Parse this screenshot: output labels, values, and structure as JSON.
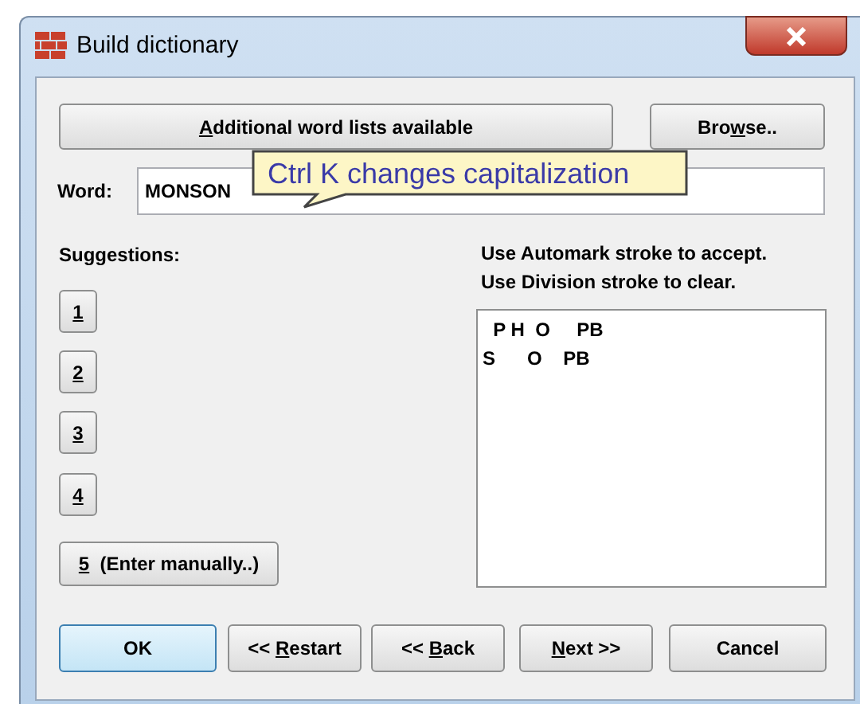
{
  "window": {
    "title": "Build dictionary"
  },
  "top_buttons": [
    {
      "label": [
        {
          "text": "A",
          "underlined": true
        },
        {
          "text": "dditional word lists available",
          "underlined": false
        }
      ]
    },
    {
      "label": [
        {
          "text": "Bro",
          "underlined": false
        },
        {
          "text": "w",
          "underlined": true
        },
        {
          "text": "se..",
          "underlined": false
        }
      ]
    }
  ],
  "word": {
    "label": "Word:",
    "value": "MONSON"
  },
  "tooltip": {
    "text": "Ctrl K changes capitalization"
  },
  "suggestions": {
    "label": "Suggestions:",
    "buttons": [
      {
        "label": [
          {
            "text": "1",
            "underlined": true
          }
        ]
      },
      {
        "label": [
          {
            "text": "2",
            "underlined": true
          }
        ]
      },
      {
        "label": [
          {
            "text": "3",
            "underlined": true
          }
        ]
      },
      {
        "label": [
          {
            "text": "4",
            "underlined": true
          }
        ]
      },
      {
        "label": [
          {
            "text": "5",
            "underlined": true
          },
          {
            "text": "  (Enter manually..)",
            "underlined": false
          }
        ]
      }
    ]
  },
  "instructions": [
    "Use Automark stroke to accept.",
    "Use Division stroke to clear."
  ],
  "strokes": [
    "  P H  O     PB",
    "S      O    PB"
  ],
  "bottom_buttons": [
    {
      "label": [
        {
          "text": "OK",
          "underlined": false
        }
      ],
      "default": true
    },
    {
      "label": [
        {
          "text": "<< ",
          "underlined": false
        },
        {
          "text": "R",
          "underlined": true
        },
        {
          "text": "estart",
          "underlined": false
        }
      ],
      "default": false
    },
    {
      "label": [
        {
          "text": "<< ",
          "underlined": false
        },
        {
          "text": "B",
          "underlined": true
        },
        {
          "text": "ack",
          "underlined": false
        }
      ],
      "default": false
    },
    {
      "label": [
        {
          "text": "N",
          "underlined": true
        },
        {
          "text": "ext >>",
          "underlined": false
        }
      ],
      "default": false
    },
    {
      "label": [
        {
          "text": "Cancel",
          "underlined": false
        }
      ],
      "default": false
    }
  ]
}
